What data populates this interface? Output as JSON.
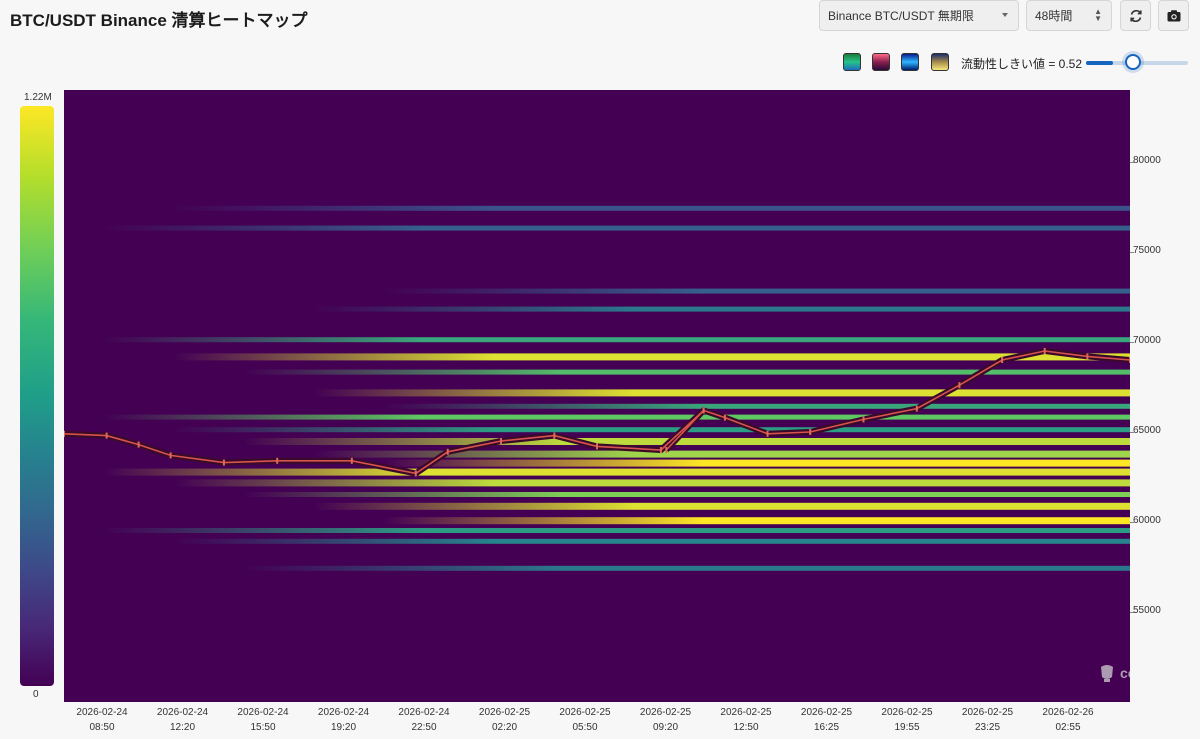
{
  "header": {
    "title": "BTC/USDT Binance 清算ヒートマップ",
    "market_select": "Binance BTC/USDT 無期限",
    "range_select": "48時間",
    "refresh_icon": "refresh-icon",
    "camera_icon": "camera-icon"
  },
  "controls": {
    "palettes": [
      "viridis",
      "magenta",
      "blue",
      "sand"
    ],
    "threshold_label": "流動性しきい値 = 0.52",
    "threshold_value": 0.52
  },
  "colorbar": {
    "max_label": "1.22M",
    "min_label": "0"
  },
  "watermark": "coinglass",
  "chart_data": {
    "type": "heatmap",
    "title": "",
    "ylim": [
      50000,
      84000
    ],
    "yticks": [
      55000,
      60000,
      65000,
      70000,
      75000,
      80000
    ],
    "ytick_labels": [
      "55000",
      "60000",
      "65000",
      "70000",
      "75000",
      "80000"
    ],
    "xtick_labels": [
      {
        "date": "2026-02-24",
        "time": "08:50"
      },
      {
        "date": "2026-02-24",
        "time": "12:20"
      },
      {
        "date": "2026-02-24",
        "time": "15:50"
      },
      {
        "date": "2026-02-24",
        "time": "19:20"
      },
      {
        "date": "2026-02-24",
        "time": "22:50"
      },
      {
        "date": "2026-02-25",
        "time": "02:20"
      },
      {
        "date": "2026-02-25",
        "time": "05:50"
      },
      {
        "date": "2026-02-25",
        "time": "09:20"
      },
      {
        "date": "2026-02-25",
        "time": "12:50"
      },
      {
        "date": "2026-02-25",
        "time": "16:25"
      },
      {
        "date": "2026-02-25",
        "time": "19:55"
      },
      {
        "date": "2026-02-25",
        "time": "23:25"
      },
      {
        "date": "2026-02-26",
        "time": "02:55"
      }
    ],
    "colorbar_range": [
      0,
      1220000
    ],
    "price_series": {
      "name": "BTC/USDT",
      "time_index": [
        0,
        0.04,
        0.07,
        0.1,
        0.15,
        0.2,
        0.27,
        0.33,
        0.36,
        0.41,
        0.46,
        0.5,
        0.56,
        0.6,
        0.565,
        0.6,
        0.62,
        0.66,
        0.7,
        0.75,
        0.8,
        0.84,
        0.88,
        0.92,
        0.96,
        1.0
      ],
      "price": [
        64900,
        64800,
        64300,
        63700,
        63300,
        63400,
        63400,
        62700,
        63900,
        64500,
        64800,
        64200,
        64000,
        66200,
        64000,
        66200,
        65800,
        64900,
        65000,
        65700,
        66300,
        67600,
        69000,
        69500,
        69200,
        69000
      ]
    },
    "liquidity_bands": [
      {
        "price": 70100,
        "intensity": 0.6
      },
      {
        "price": 69200,
        "intensity": 0.95
      },
      {
        "price": 68300,
        "intensity": 0.7
      },
      {
        "price": 67200,
        "intensity": 0.95
      },
      {
        "price": 66400,
        "intensity": 0.6
      },
      {
        "price": 65800,
        "intensity": 0.75
      },
      {
        "price": 65100,
        "intensity": 0.55
      },
      {
        "price": 64500,
        "intensity": 0.9
      },
      {
        "price": 63800,
        "intensity": 0.85
      },
      {
        "price": 63300,
        "intensity": 1.0
      },
      {
        "price": 62800,
        "intensity": 0.95
      },
      {
        "price": 62200,
        "intensity": 0.9
      },
      {
        "price": 61500,
        "intensity": 0.8
      },
      {
        "price": 60900,
        "intensity": 0.95
      },
      {
        "price": 60100,
        "intensity": 1.0
      },
      {
        "price": 59500,
        "intensity": 0.55
      },
      {
        "price": 58900,
        "intensity": 0.45
      },
      {
        "price": 57400,
        "intensity": 0.4
      },
      {
        "price": 71800,
        "intensity": 0.4
      },
      {
        "price": 72800,
        "intensity": 0.3
      },
      {
        "price": 76300,
        "intensity": 0.3
      },
      {
        "price": 77400,
        "intensity": 0.25
      }
    ]
  }
}
